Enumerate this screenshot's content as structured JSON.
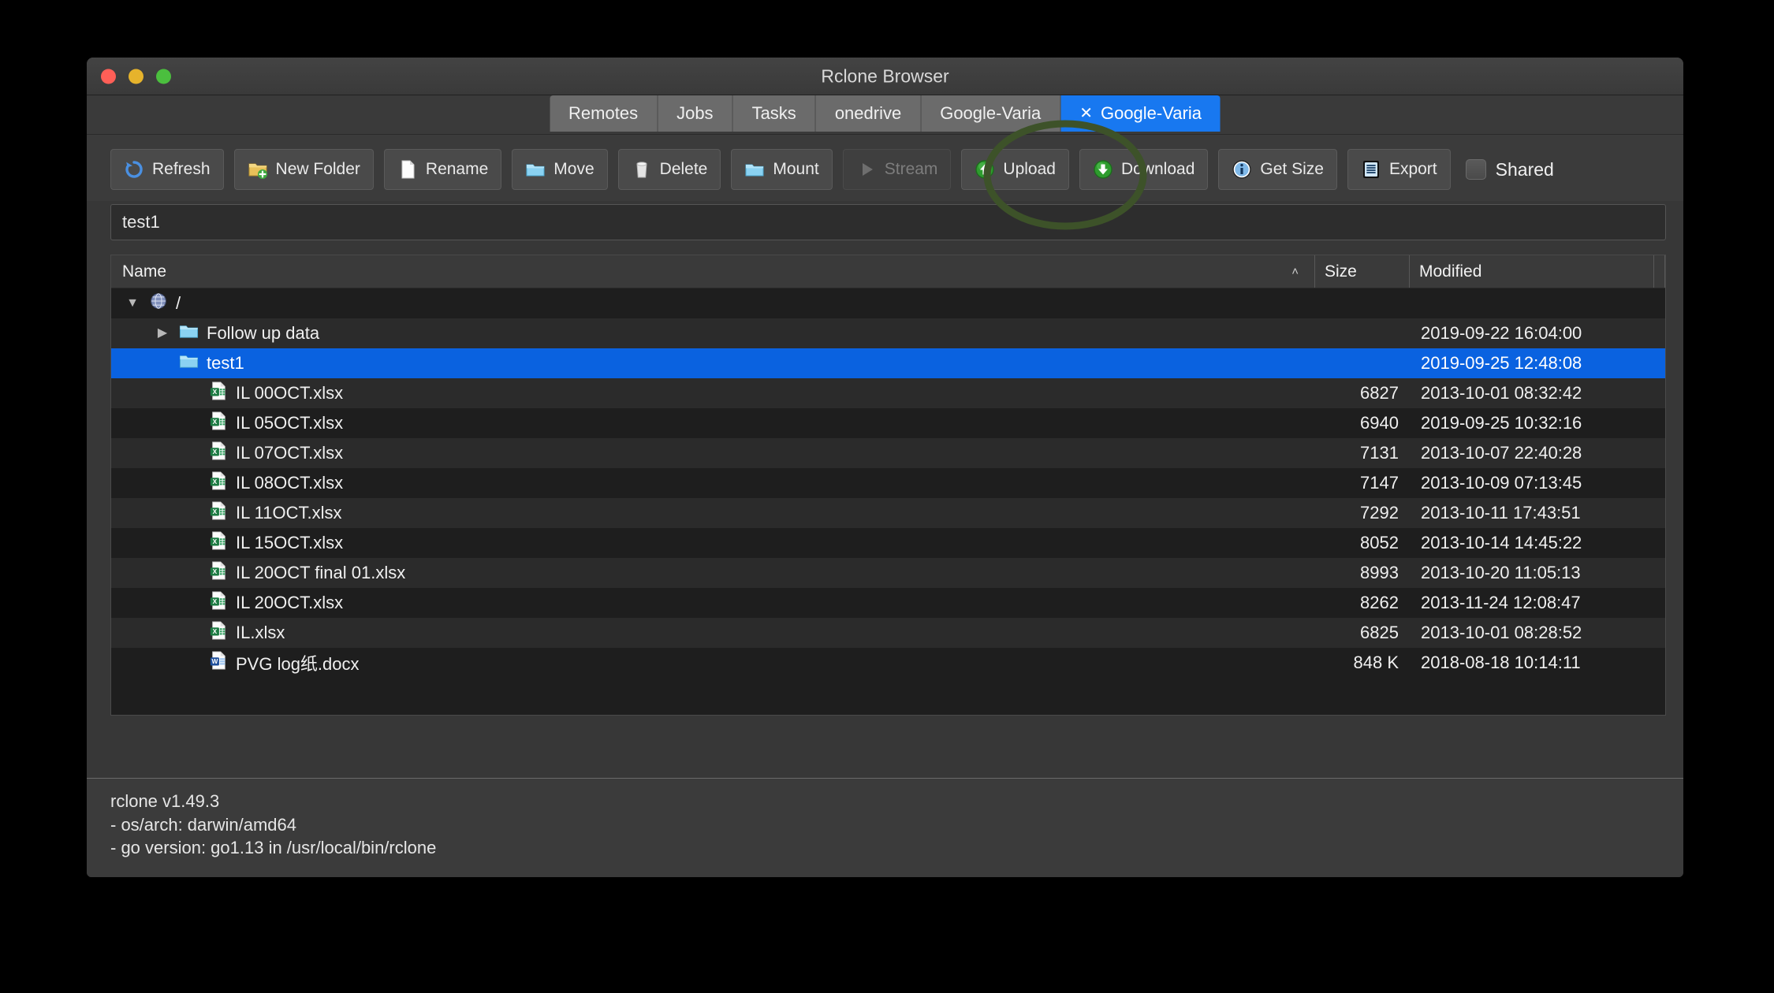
{
  "window": {
    "title": "Rclone Browser",
    "traffic_lights": [
      "close-button",
      "minimize-button",
      "zoom-button"
    ]
  },
  "tabs": [
    {
      "label": "Remotes",
      "active": false,
      "closable": false
    },
    {
      "label": "Jobs",
      "active": false,
      "closable": false
    },
    {
      "label": "Tasks",
      "active": false,
      "closable": false
    },
    {
      "label": "onedrive",
      "active": false,
      "closable": false
    },
    {
      "label": "Google-Varia",
      "active": false,
      "closable": false
    },
    {
      "label": "Google-Varia",
      "active": true,
      "closable": true,
      "close_glyph": "✕"
    }
  ],
  "toolbar": {
    "buttons": [
      {
        "label": "Refresh",
        "icon": "refresh-icon",
        "disabled": false,
        "flat": false
      },
      {
        "label": "New Folder",
        "icon": "new-folder-icon",
        "disabled": false,
        "flat": false
      },
      {
        "label": "Rename",
        "icon": "rename-icon",
        "disabled": false,
        "flat": false
      },
      {
        "label": "Move",
        "icon": "move-folder-icon",
        "disabled": false,
        "flat": false
      },
      {
        "label": "Delete",
        "icon": "trash-icon",
        "disabled": false,
        "flat": false
      },
      {
        "label": "Mount",
        "icon": "mount-folder-icon",
        "disabled": false,
        "flat": false
      },
      {
        "label": "Stream",
        "icon": "play-icon",
        "disabled": true,
        "flat": true
      },
      {
        "label": "Upload",
        "icon": "upload-arrow-icon",
        "disabled": false,
        "flat": false
      },
      {
        "label": "Download",
        "icon": "download-arrow-icon",
        "disabled": false,
        "flat": false
      },
      {
        "label": "Get Size",
        "icon": "info-icon",
        "disabled": false,
        "flat": false
      },
      {
        "label": "Export",
        "icon": "export-list-icon",
        "disabled": false,
        "flat": false
      }
    ],
    "shared_checkbox": {
      "label": "Shared",
      "checked": false
    }
  },
  "path_field": {
    "value": "test1"
  },
  "tree": {
    "columns": {
      "name": "Name",
      "size": "Size",
      "modified": "Modified",
      "sort_column": "Name",
      "sort_caret": "˄"
    },
    "rows": [
      {
        "name": "/",
        "icon": "globe-icon",
        "twisty": "▼",
        "indent": 0,
        "size": "",
        "modified": "",
        "selected": false
      },
      {
        "name": "Follow up data",
        "icon": "folder-icon",
        "twisty": "▶",
        "indent": 1,
        "size": "",
        "modified": "2019-09-22 16:04:00",
        "selected": false
      },
      {
        "name": "test1",
        "icon": "folder-icon",
        "twisty": "",
        "indent": 1,
        "size": "",
        "modified": "2019-09-25 12:48:08",
        "selected": true
      },
      {
        "name": "IL 00OCT.xlsx",
        "icon": "excel-file-icon",
        "twisty": "",
        "indent": 2,
        "size": "6827",
        "modified": "2013-10-01 08:32:42",
        "selected": false
      },
      {
        "name": "IL 05OCT.xlsx",
        "icon": "excel-file-icon",
        "twisty": "",
        "indent": 2,
        "size": "6940",
        "modified": "2019-09-25 10:32:16",
        "selected": false
      },
      {
        "name": "IL 07OCT.xlsx",
        "icon": "excel-file-icon",
        "twisty": "",
        "indent": 2,
        "size": "7131",
        "modified": "2013-10-07 22:40:28",
        "selected": false
      },
      {
        "name": "IL 08OCT.xlsx",
        "icon": "excel-file-icon",
        "twisty": "",
        "indent": 2,
        "size": "7147",
        "modified": "2013-10-09 07:13:45",
        "selected": false
      },
      {
        "name": "IL 11OCT.xlsx",
        "icon": "excel-file-icon",
        "twisty": "",
        "indent": 2,
        "size": "7292",
        "modified": "2013-10-11 17:43:51",
        "selected": false
      },
      {
        "name": "IL 15OCT.xlsx",
        "icon": "excel-file-icon",
        "twisty": "",
        "indent": 2,
        "size": "8052",
        "modified": "2013-10-14 14:45:22",
        "selected": false
      },
      {
        "name": "IL 20OCT final 01.xlsx",
        "icon": "excel-file-icon",
        "twisty": "",
        "indent": 2,
        "size": "8993",
        "modified": "2013-10-20 11:05:13",
        "selected": false
      },
      {
        "name": "IL 20OCT.xlsx",
        "icon": "excel-file-icon",
        "twisty": "",
        "indent": 2,
        "size": "8262",
        "modified": "2013-11-24 12:08:47",
        "selected": false
      },
      {
        "name": "IL.xlsx",
        "icon": "excel-file-icon",
        "twisty": "",
        "indent": 2,
        "size": "6825",
        "modified": "2013-10-01 08:28:52",
        "selected": false
      },
      {
        "name": "PVG log纸.docx",
        "icon": "word-file-icon",
        "twisty": "",
        "indent": 2,
        "size": "848 K",
        "modified": "2018-08-18 10:14:11",
        "selected": false
      }
    ]
  },
  "footer": {
    "line1": "rclone v1.49.3",
    "line2": "- os/arch: darwin/amd64",
    "line3": "- go version: go1.13 in /usr/local/bin/rclone"
  },
  "annotation": {
    "shape": "ellipse",
    "color": "#3d5229",
    "targets": "upload-button"
  },
  "colors": {
    "selection_blue": "#0a62e0",
    "active_tab_blue": "#1878f0",
    "window_chrome": "#3b3b3b",
    "tree_background": "#1e1e1e",
    "annotation_green": "#3d5229"
  }
}
